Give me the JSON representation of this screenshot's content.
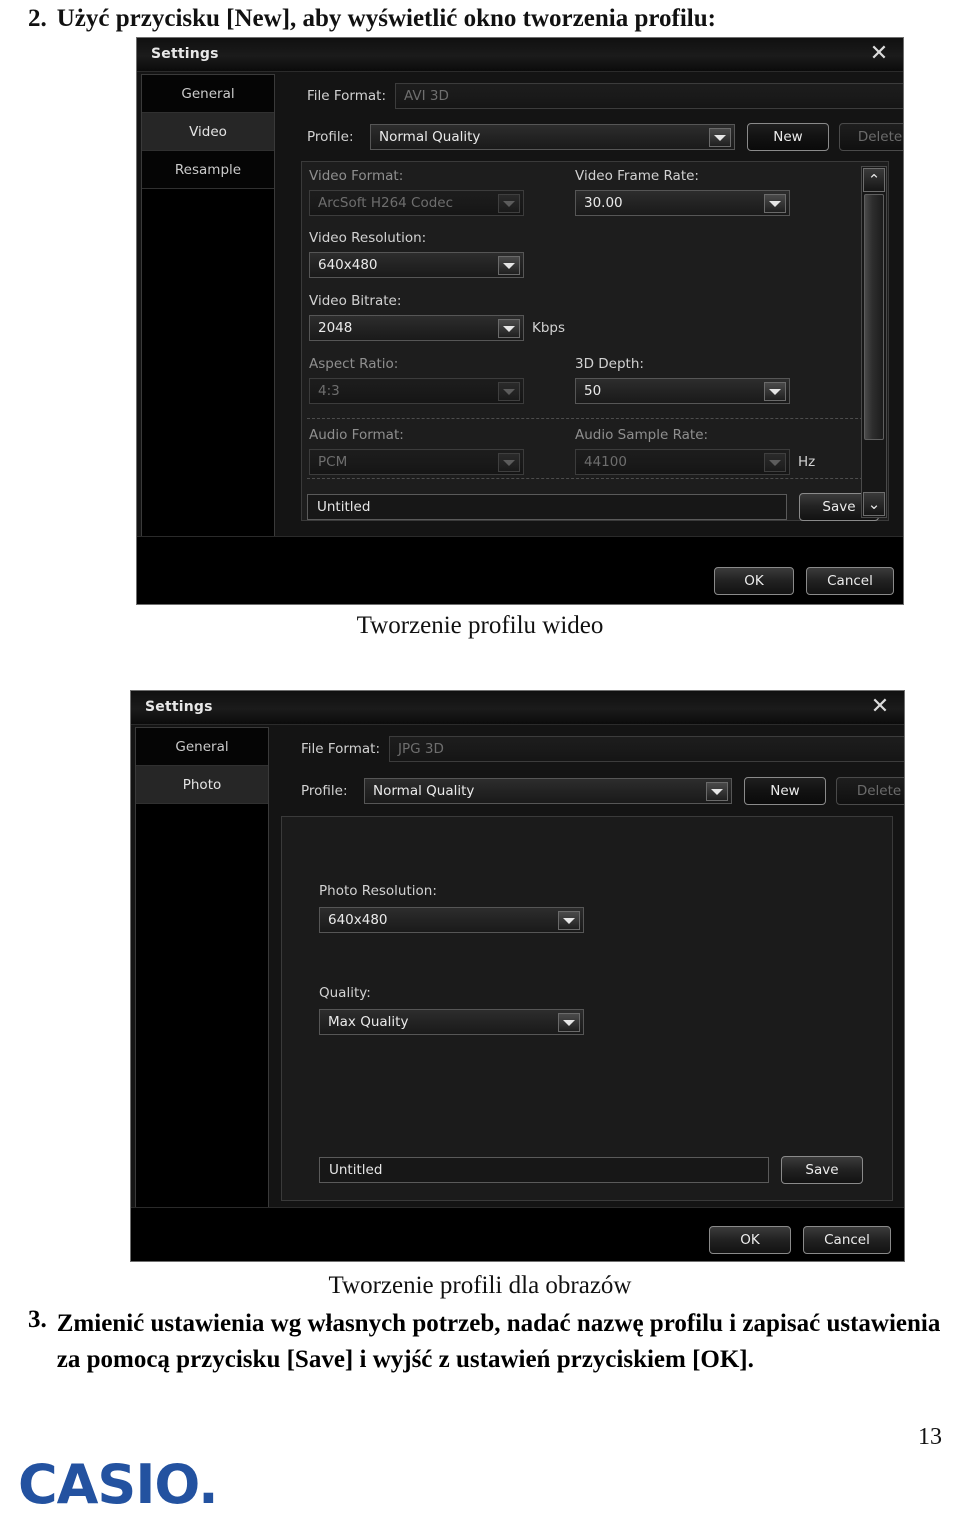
{
  "document": {
    "step2": {
      "number": "2.",
      "text": "Użyć przycisku [New], aby wyświetlić okno tworzenia profilu:"
    },
    "caption1": "Tworzenie profilu wideo",
    "caption2": "Tworzenie profili dla obrazów",
    "step3": {
      "number": "3.",
      "text": "Zmienić ustawienia wg własnych potrzeb, nadać nazwę profilu i zapisać ustawienia za pomocą przycisku [Save] i wyjść z ustawień przyciskiem [OK]."
    },
    "page_number": "13",
    "brand": "CASIO",
    "brand_dot": "."
  },
  "video_dialog": {
    "title": "Settings",
    "close_label": "✕",
    "sidebar": [
      {
        "label": "General",
        "selected": false
      },
      {
        "label": "Video",
        "selected": true
      },
      {
        "label": "Resample",
        "selected": false
      }
    ],
    "file_format": {
      "label": "File Format:",
      "value": "AVI 3D",
      "disabled": true
    },
    "profile": {
      "label": "Profile:",
      "value": "Normal Quality",
      "disabled": false
    },
    "new_button": "New",
    "delete_button": "Delete",
    "fields": {
      "video_format": {
        "label": "Video Format:",
        "value": "ArcSoft H264 Codec",
        "disabled": true
      },
      "video_frame_rate": {
        "label": "Video Frame Rate:",
        "value": "30.00",
        "disabled": false
      },
      "video_resolution": {
        "label": "Video Resolution:",
        "value": "640x480",
        "disabled": false
      },
      "video_bitrate": {
        "label": "Video Bitrate:",
        "value": "2048",
        "disabled": false,
        "unit": "Kbps"
      },
      "aspect_ratio": {
        "label": "Aspect Ratio:",
        "value": "4:3",
        "disabled": true
      },
      "depth_3d": {
        "label": "3D Depth:",
        "value": "50",
        "disabled": false
      },
      "audio_format": {
        "label": "Audio Format:",
        "value": "PCM",
        "disabled": true
      },
      "audio_sample_rate": {
        "label": "Audio Sample Rate:",
        "value": "44100",
        "disabled": true,
        "unit": "Hz"
      }
    },
    "profile_name": {
      "value": "Untitled",
      "save_button": "Save"
    },
    "ok_button": "OK",
    "cancel_button": "Cancel",
    "scroll_up": "⌃",
    "scroll_down": "⌄"
  },
  "photo_dialog": {
    "title": "Settings",
    "close_label": "✕",
    "sidebar": [
      {
        "label": "General",
        "selected": false
      },
      {
        "label": "Photo",
        "selected": true
      }
    ],
    "file_format": {
      "label": "File Format:",
      "value": "JPG 3D",
      "disabled": true
    },
    "profile": {
      "label": "Profile:",
      "value": "Normal Quality",
      "disabled": false
    },
    "new_button": "New",
    "delete_button": "Delete",
    "fields": {
      "photo_resolution": {
        "label": "Photo Resolution:",
        "value": "640x480",
        "disabled": false
      },
      "quality": {
        "label": "Quality:",
        "value": "Max Quality",
        "disabled": false
      }
    },
    "profile_name": {
      "value": "Untitled",
      "save_button": "Save"
    },
    "ok_button": "OK",
    "cancel_button": "Cancel"
  },
  "colors": {
    "brand_blue": "#2352a0",
    "dialog_bg": "#141414",
    "panel_bg": "#1d1d1d",
    "text": "#d2d2d2"
  }
}
